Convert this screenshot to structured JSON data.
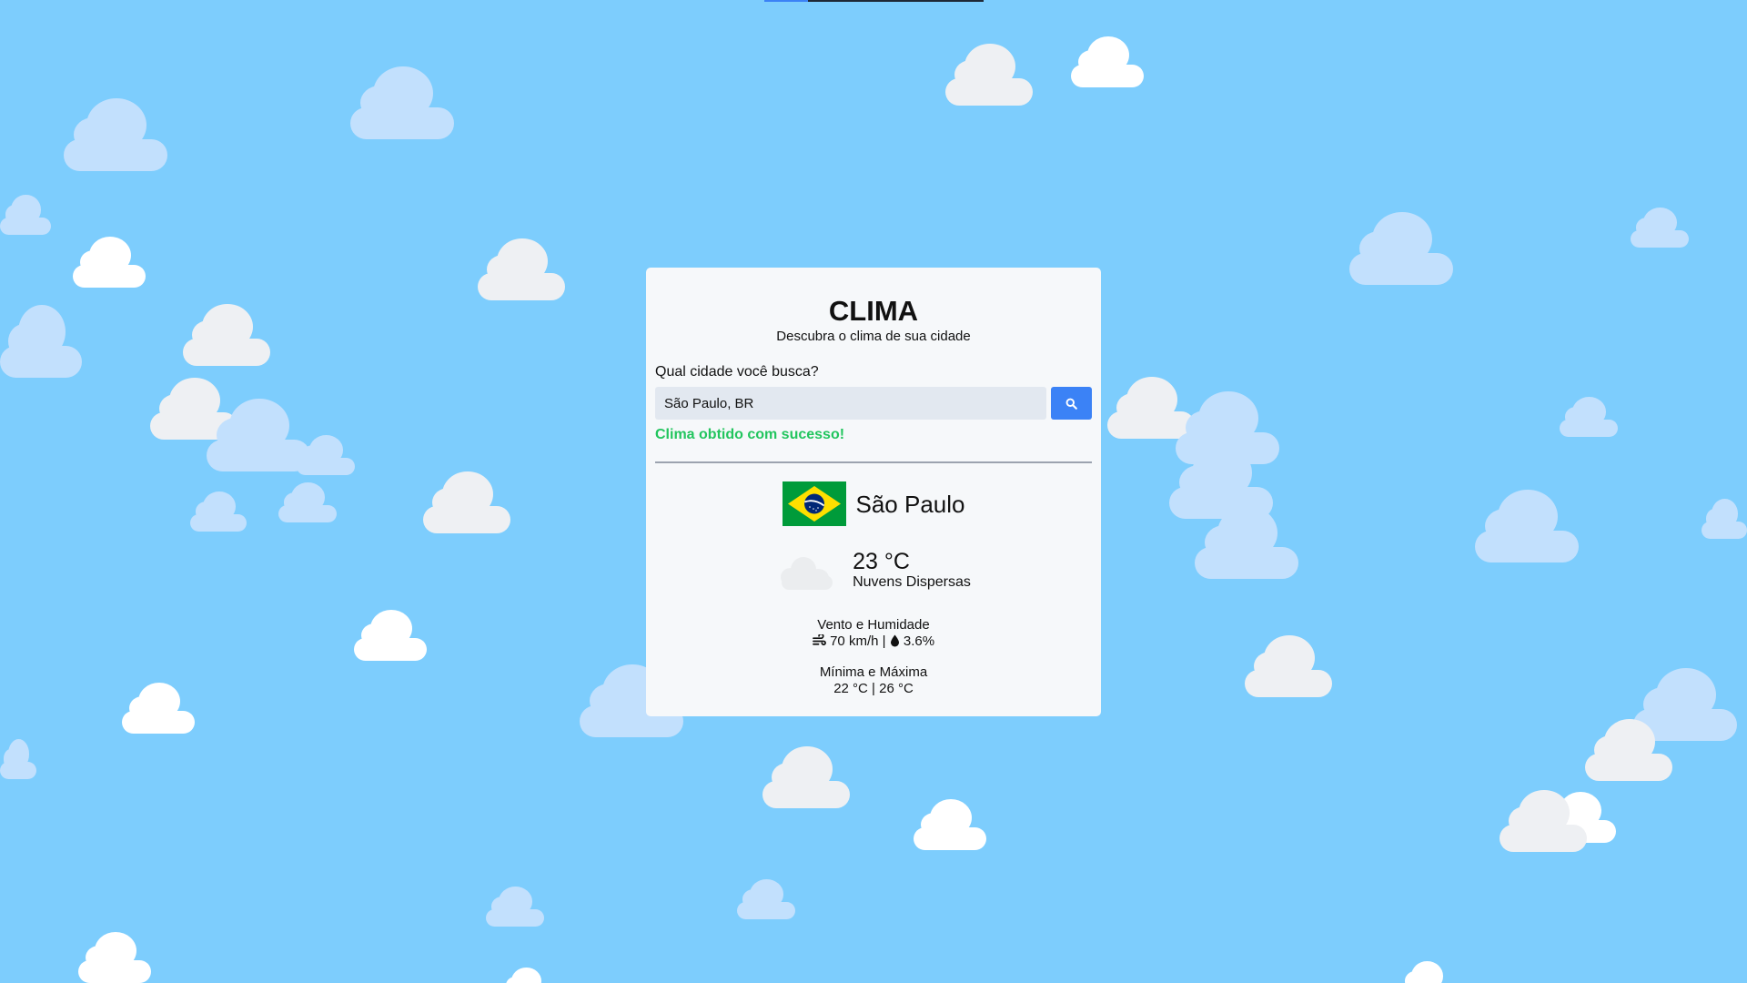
{
  "app": {
    "title": "CLIMA",
    "subtitle": "Descubra o clima de sua cidade"
  },
  "search": {
    "label": "Qual cidade você busca?",
    "value": "São Paulo, BR",
    "placeholder": "",
    "button_icon": "search-icon"
  },
  "status": {
    "message": "Clima obtido com sucesso!",
    "color": "#22c55e"
  },
  "weather": {
    "city": "São Paulo",
    "country_flag": "brazil-flag-icon",
    "icon": "scattered-clouds-icon",
    "temperature": "23 °C",
    "description": "Nuvens Dispersas",
    "wind_humidity_title": "Vento e Humidade",
    "wind": "70 km/h",
    "separator": "|",
    "humidity": "3.6%",
    "min_max_title": "Mínima e Máxima",
    "min_max": "22 °C | 26 °C"
  },
  "colors": {
    "background": "#7dcdfd",
    "card": "#f6f8fa",
    "accent": "#3b82f6",
    "success": "#22c55e"
  }
}
